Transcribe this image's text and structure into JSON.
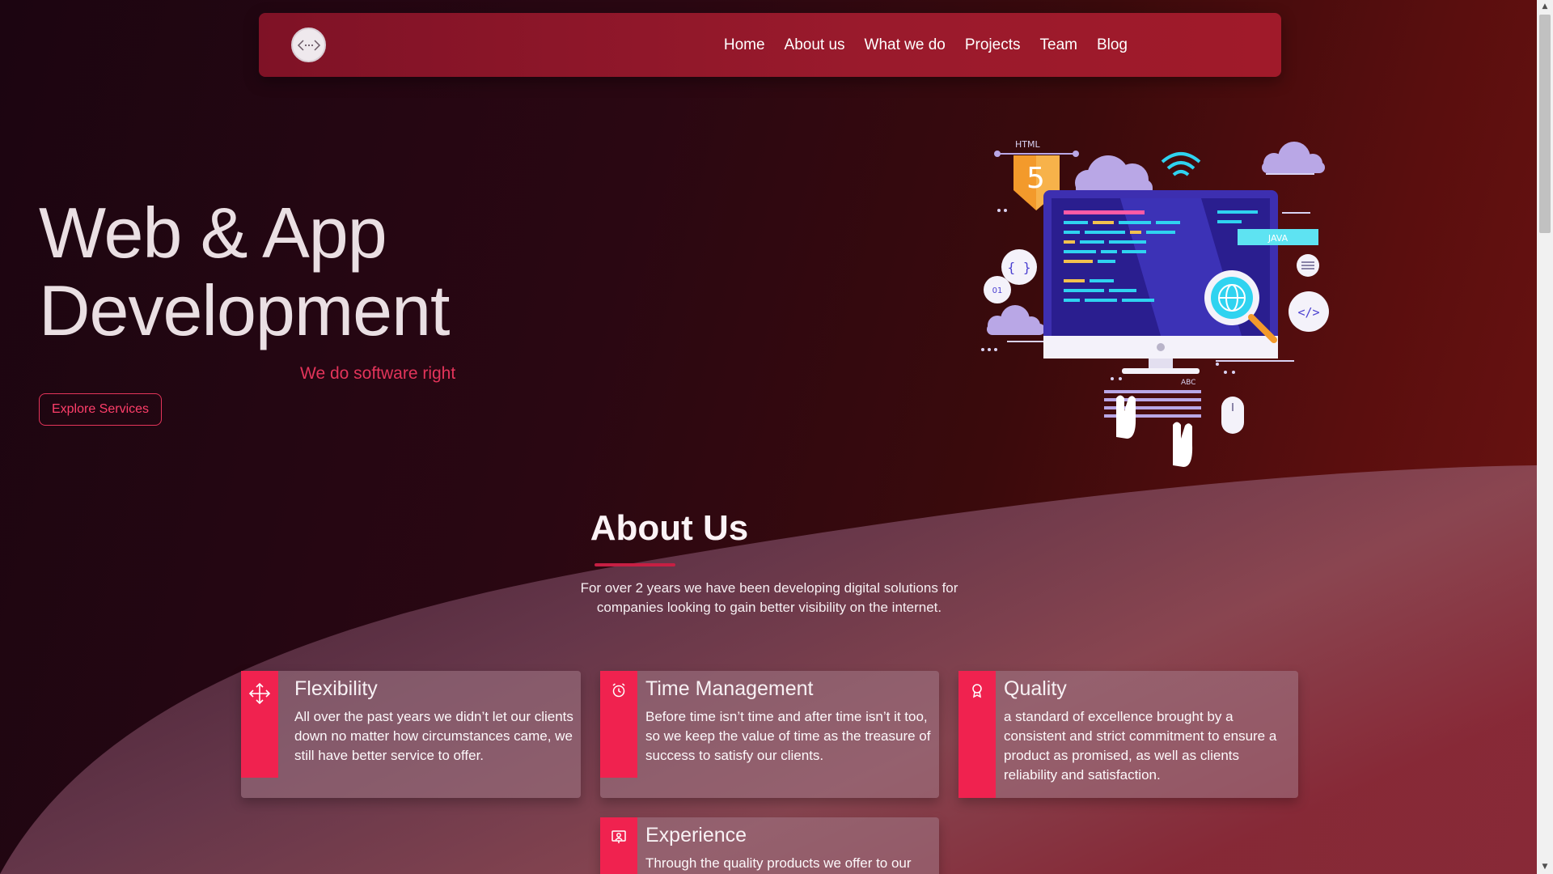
{
  "nav": {
    "logo_icon": "code-brackets-icon",
    "links": [
      "Home",
      "About us",
      "What we do",
      "Projects",
      "Team",
      "Blog"
    ]
  },
  "hero": {
    "title_line1": "Web & App",
    "title_line2": "Development",
    "tagline": "We do software right",
    "cta": "Explore Services",
    "illustration": {
      "html_label": "HTML",
      "html_number": "5",
      "java_label": "JAVA",
      "binary_label": "01",
      "braces_label": "{ }",
      "code_label": "</>",
      "keyboard_label": "ABC"
    }
  },
  "about": {
    "title": "About Us",
    "text": "For over 2 years we have been developing digital solutions for companies looking to gain better visibility on the internet."
  },
  "cards": [
    {
      "icon": "move-arrows-icon",
      "title": "Flexibility",
      "text": "All over the past years we didn’t let our clients down no matter how circumstances came, we still have better service to offer."
    },
    {
      "icon": "alarm-clock-icon",
      "title": "Time Management",
      "text": "Before time isn’t time and after time isn’t it too, so we keep the value of time as the treasure of success to satisfy our clients."
    },
    {
      "icon": "award-icon",
      "title": "Quality",
      "text": "a standard of excellence brought by a consistent and strict commitment to ensure a product as promised, as well as clients reliability and satisfaction."
    },
    {
      "icon": "presenter-icon",
      "title": "Experience",
      "text": "Through the quality products we offer to our"
    }
  ],
  "colors": {
    "accent": "#f0224f",
    "navbar": "#9a1a2c",
    "background_dark": "#1c0511",
    "background_red": "#6e1412"
  }
}
